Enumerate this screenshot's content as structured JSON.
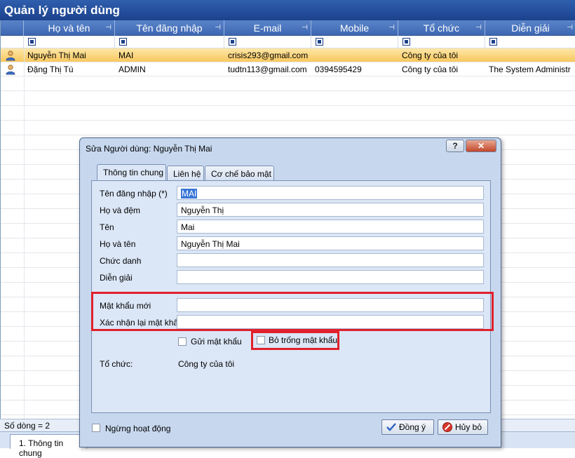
{
  "app": {
    "title": "Quản lý người dùng"
  },
  "grid": {
    "columns": [
      "Họ và tên",
      "Tên đăng nhập",
      "E-mail",
      "Mobile",
      "Tổ chức",
      "Diễn giải"
    ],
    "rows": [
      {
        "full_name": "Nguyễn Thị Mai",
        "username": "MAI",
        "email": "crisis293@gmail.com",
        "mobile": "",
        "org": "Công ty của tôi",
        "desc": ""
      },
      {
        "full_name": "Đặng Thị Tú",
        "username": "ADMIN",
        "email": "tudtn113@gmail.com",
        "mobile": "0394595429",
        "org": "Công ty của tôi",
        "desc": "The System Administr"
      }
    ]
  },
  "status": {
    "row_count": "Số dòng = 2"
  },
  "bottom_tab": {
    "label": "1. Thông tin chung"
  },
  "dialog": {
    "title": "Sửa Người dùng: Nguyễn Thị Mai",
    "help_label": "?",
    "close_label": "✕",
    "tabs": [
      "Thông tin chung",
      "Liên hệ",
      "Cơ chế bảo mật"
    ],
    "fields": {
      "username_label": "Tên đăng nhập (*)",
      "username_value": "MAI",
      "lastname_label": "Họ và đệm",
      "lastname_value": "Nguyễn Thị",
      "firstname_label": "Tên",
      "firstname_value": "Mai",
      "fullname_label": "Họ và tên",
      "fullname_value": "Nguyễn Thị Mai",
      "title_label": "Chức danh",
      "title_value": "",
      "desc_label": "Diễn giải",
      "desc_value": "",
      "new_password_label": "Mật khẩu mới",
      "new_password_value": "",
      "confirm_password_label": "Xác nhận lại mật khẩu",
      "confirm_password_value": "",
      "send_password_label": "Gửi mật khẩu",
      "blank_password_label": "Bỏ trống mật khẩu",
      "org_label": "Tổ chức:",
      "org_value": "Công ty của tôi"
    },
    "inactive_label": "Ngừng hoạt động",
    "ok_label": "Đồng ý",
    "cancel_label": "Hủy bỏ"
  },
  "colors": {
    "title_bar": "#1c428c",
    "selected_row": "#f9c85f",
    "highlight": "#e0202c"
  }
}
